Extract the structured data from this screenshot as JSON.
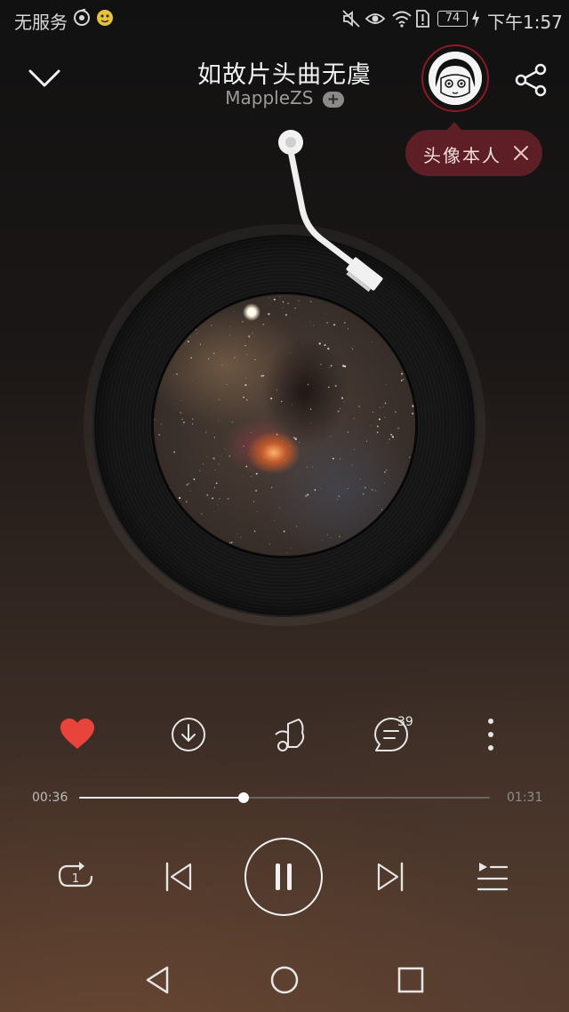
{
  "status_bar": {
    "carrier": "无服务",
    "battery": "74",
    "time": "下午1:57",
    "icons": [
      "sync-icon",
      "app-notification-icon",
      "mute-icon",
      "eye-comfort-icon",
      "wifi-icon",
      "sim-alert-icon",
      "battery-icon",
      "charging-icon"
    ]
  },
  "header": {
    "title": "如故片头曲无虞",
    "artist": "MappleZS",
    "follow_label": "+",
    "icons": [
      "chevron-down-icon",
      "share-icon"
    ]
  },
  "tooltip": {
    "text": "头像本人"
  },
  "actions": {
    "icons": [
      "heart-icon",
      "download-icon",
      "sound-effect-icon",
      "comment-icon",
      "more-icon"
    ],
    "comment_count": "39",
    "liked": true,
    "like_color": "#e8443c"
  },
  "progress": {
    "current": "00:36",
    "total": "01:31",
    "fraction": 0.4
  },
  "controls": {
    "icons": [
      "repeat-one-icon",
      "previous-icon",
      "pause-icon",
      "next-icon",
      "playlist-icon"
    ]
  },
  "nav_bar": {
    "icons": [
      "back-icon",
      "home-icon",
      "recents-icon"
    ]
  },
  "colors": {
    "accent": "#8a1b24",
    "tooltip_bg": "#5e1e25"
  }
}
